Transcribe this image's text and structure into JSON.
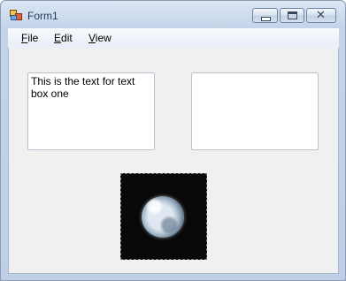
{
  "window": {
    "title": "Form1"
  },
  "menu": {
    "items": [
      "File",
      "Edit",
      "View"
    ]
  },
  "textboxes": {
    "one": {
      "value": "This is the text for text box one"
    },
    "two": {
      "value": ""
    }
  },
  "picture": {
    "content": "moon-image"
  },
  "icons": {
    "app": "form-app-icon",
    "minimize": "minimize-icon",
    "maximize": "maximize-icon",
    "close": "close-icon"
  }
}
